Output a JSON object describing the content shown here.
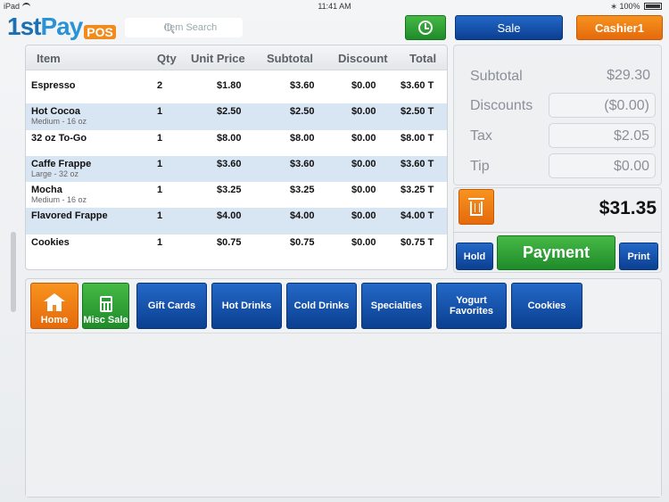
{
  "status_bar": {
    "device": "iPad",
    "time": "11:41 AM",
    "battery": "100%"
  },
  "header": {
    "logo_one": "1st",
    "logo_pay": "Pay",
    "logo_pos": "POS",
    "search_placeholder": "Item Search",
    "sale_label": "Sale",
    "cashier_label": "Cashier1"
  },
  "order_table": {
    "columns": [
      "Item",
      "Qty",
      "Unit Price",
      "Subtotal",
      "Discount",
      "Total"
    ],
    "rows": [
      {
        "item": "Espresso",
        "modifier": "",
        "qty": "2",
        "unit_price": "$1.80",
        "subtotal": "$3.60",
        "discount": "$0.00",
        "total": "$3.60 T"
      },
      {
        "item": "Hot Cocoa",
        "modifier": "Medium - 16 oz",
        "qty": "1",
        "unit_price": "$2.50",
        "subtotal": "$2.50",
        "discount": "$0.00",
        "total": "$2.50 T"
      },
      {
        "item": "32 oz To-Go",
        "modifier": "",
        "qty": "1",
        "unit_price": "$8.00",
        "subtotal": "$8.00",
        "discount": "$0.00",
        "total": "$8.00 T"
      },
      {
        "item": "Caffe Frappe",
        "modifier": "Large - 32 oz",
        "qty": "1",
        "unit_price": "$3.60",
        "subtotal": "$3.60",
        "discount": "$0.00",
        "total": "$3.60 T"
      },
      {
        "item": "Mocha",
        "modifier": "Medium - 16 oz",
        "qty": "1",
        "unit_price": "$3.25",
        "subtotal": "$3.25",
        "discount": "$0.00",
        "total": "$3.25 T"
      },
      {
        "item": "Flavored Frappe",
        "modifier": "",
        "qty": "1",
        "unit_price": "$4.00",
        "subtotal": "$4.00",
        "discount": "$0.00",
        "total": "$4.00 T"
      },
      {
        "item": "Cookies",
        "modifier": "",
        "qty": "1",
        "unit_price": "$0.75",
        "subtotal": "$0.75",
        "discount": "$0.00",
        "total": "$0.75 T"
      }
    ]
  },
  "totals": {
    "subtotal_label": "Subtotal",
    "subtotal": "$29.30",
    "discounts_label": "Discounts",
    "discounts": "($0.00)",
    "tax_label": "Tax",
    "tax": "$2.05",
    "tip_label": "Tip",
    "tip": "$0.00",
    "grand_total": "$31.35"
  },
  "actions": {
    "hold": "Hold",
    "payment": "Payment",
    "print": "Print"
  },
  "categories": {
    "home": "Home",
    "misc_sale": "Misc Sale",
    "items": [
      "Gift Cards",
      "Hot Drinks",
      "Cold Drinks",
      "Specialties",
      "Yogurt Favorites",
      "Cookies"
    ]
  },
  "colors": {
    "green": "#1f8b2a",
    "blue": "#0b3f91",
    "orange": "#e56a0c",
    "row_alt": "#d8e5f2"
  }
}
